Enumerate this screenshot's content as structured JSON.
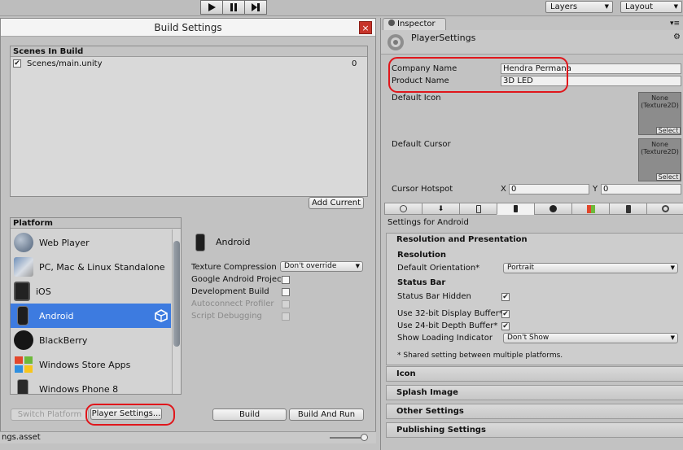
{
  "toolbar": {
    "layers_label": "Layers",
    "layout_label": "Layout"
  },
  "build_settings": {
    "title": "Build Settings",
    "close_glyph": "×",
    "scenes_header": "Scenes In Build",
    "scenes": [
      {
        "name": "Scenes/main.unity",
        "index": "0",
        "checked": "✔"
      }
    ],
    "add_current_label": "Add Current",
    "platform_header": "Platform",
    "platforms": [
      {
        "label": "Web Player",
        "icon": "globe-icon"
      },
      {
        "label": "PC, Mac & Linux Standalone",
        "icon": "pc-mac-linux-icon"
      },
      {
        "label": "iOS",
        "icon": "ios-icon"
      },
      {
        "label": "Android",
        "icon": "android-icon",
        "selected": true
      },
      {
        "label": "BlackBerry",
        "icon": "blackberry-icon"
      },
      {
        "label": "Windows Store Apps",
        "icon": "windows-icon"
      },
      {
        "label": "Windows Phone 8",
        "icon": "windows-phone-icon"
      }
    ],
    "selected_platform_title": "Android",
    "options": {
      "texture_compression_label": "Texture Compression",
      "texture_compression_value": "Don't override",
      "google_android_project_label": "Google Android Project",
      "development_build_label": "Development Build",
      "autoconnect_profiler_label": "Autoconnect Profiler",
      "script_debugging_label": "Script Debugging"
    },
    "switch_platform_label": "Switch Platform",
    "player_settings_label": "Player Settings...",
    "build_label": "Build",
    "build_and_run_label": "Build And Run"
  },
  "status_bar_text": "ngs.asset",
  "inspector": {
    "tab_label": "Inspector",
    "title": "PlayerSettings",
    "company_name_label": "Company Name",
    "company_name_value": "Hendra Permana",
    "product_name_label": "Product Name",
    "product_name_value": "3D LED",
    "default_icon_label": "Default Icon",
    "default_cursor_label": "Default Cursor",
    "texture_none_text": "None\n(Texture2D)",
    "select_label": "Select",
    "cursor_hotspot_label": "Cursor Hotspot",
    "hotspot_x_label": "X",
    "hotspot_x_value": "0",
    "hotspot_y_label": "Y",
    "hotspot_y_value": "0",
    "settings_for": "Settings for Android",
    "platform_tabs": [
      "globe-icon",
      "download-icon",
      "phone-icon",
      "android-icon",
      "blackberry-icon",
      "windows-icon",
      "windows-phone-icon",
      "tizen-icon"
    ],
    "resolution_section": {
      "header": "Resolution and Presentation",
      "resolution_label": "Resolution",
      "default_orientation_label": "Default Orientation*",
      "default_orientation_value": "Portrait",
      "status_bar_label": "Status Bar",
      "status_bar_hidden_label": "Status Bar Hidden",
      "use_32bit_label": "Use 32-bit Display Buffer*",
      "use_24bit_label": "Use 24-bit Depth Buffer*",
      "show_loading_label": "Show Loading Indicator",
      "show_loading_value": "Don't Show",
      "shared_note": "* Shared setting between multiple platforms."
    },
    "sections": [
      "Icon",
      "Splash Image",
      "Other Settings",
      "Publishing Settings"
    ]
  },
  "colors": {
    "selection_blue": "#3d7be0",
    "annotation_red": "#e0161b"
  }
}
